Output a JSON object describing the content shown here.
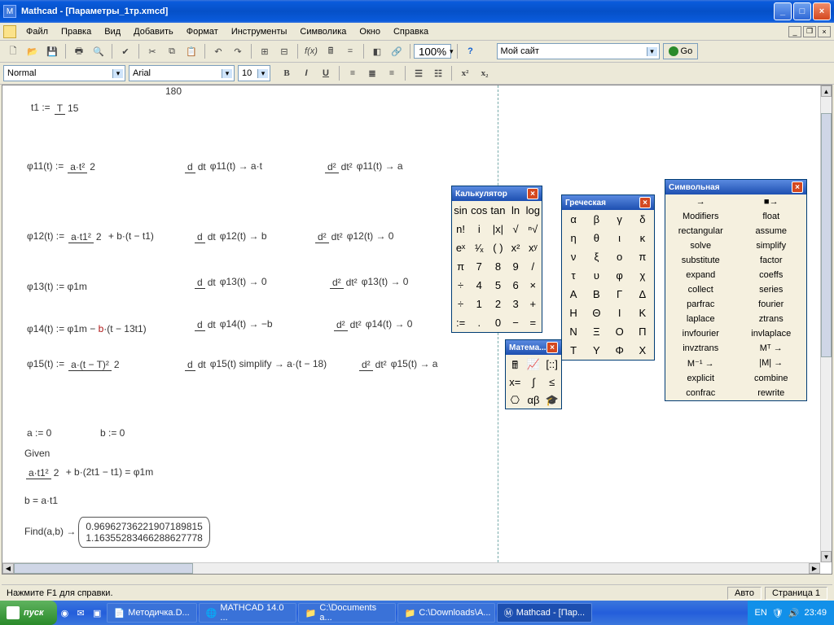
{
  "app": {
    "title": "Mathcad - [Параметры_1тр.xmcd]"
  },
  "menu": {
    "file": "Файл",
    "edit": "Правка",
    "view": "Вид",
    "insert": "Добавить",
    "format": "Формат",
    "tools": "Инструменты",
    "symbol": "Символика",
    "window": "Окно",
    "help": "Справка"
  },
  "tb2": {
    "zoom": "100%",
    "go": "Go",
    "site": "Мой сайт"
  },
  "tb3": {
    "style": "Normal",
    "font": "Arial",
    "size": "10"
  },
  "status": {
    "hint": "Нажмите F1 для справки.",
    "auto": "Авто",
    "page": "Страница 1"
  },
  "task": {
    "start": "пуск",
    "i1": "Методичка.D...",
    "i2": "MATHCAD 14.0 ...",
    "i3": "C:\\Documents a...",
    "i4": "C:\\Downloads\\A...",
    "i5": "Mathcad - [Пар...",
    "lang": "EN",
    "time": "23:49"
  },
  "pal": {
    "calc_title": "Калькулятор",
    "calc": [
      "sin",
      "cos",
      "tan",
      "ln",
      "log",
      "n!",
      "i",
      "|x|",
      "√",
      "ⁿ√",
      "eˣ",
      "¹⁄ₓ",
      "( )",
      "x²",
      "xʸ",
      "π",
      "7",
      "8",
      "9",
      "/",
      "÷",
      "4",
      "5",
      "6",
      "×",
      "÷",
      "1",
      "2",
      "3",
      "+",
      ":=",
      ".",
      "0",
      "−",
      "="
    ],
    "greek_title": "Греческая",
    "greek": [
      "α",
      "β",
      "γ",
      "δ",
      "η",
      "θ",
      "ι",
      "κ",
      "ν",
      "ξ",
      "ο",
      "π",
      "τ",
      "υ",
      "φ",
      "χ",
      "Α",
      "Β",
      "Γ",
      "Δ",
      "Η",
      "Θ",
      "Ι",
      "Κ",
      "Ν",
      "Ξ",
      "Ο",
      "Π",
      "Τ",
      "Υ",
      "Φ",
      "Χ"
    ],
    "sym_title": "Символьная",
    "sym": [
      "→",
      "■→",
      "Modifiers",
      "float",
      "rectangular",
      "assume",
      "solve",
      "simplify",
      "substitute",
      "factor",
      "expand",
      "coeffs",
      "collect",
      "series",
      "parfrac",
      "fourier",
      "laplace",
      "ztrans",
      "invfourier",
      "invlaplace",
      "invztrans",
      "Mᵀ →",
      "M⁻¹ →",
      "|M| →",
      "explicit",
      "combine",
      "confrac",
      "rewrite"
    ],
    "math_title": "Матема..."
  },
  "eq": {
    "t1": "t1 :=",
    "t1n": "T",
    "t1d": "15",
    "top": "180",
    "p11": "φ11(t) :=",
    "p11n": "a·t²",
    "p11d": "2",
    "d1": "φ11(t) → a·t",
    "dd1": "φ11(t) → a",
    "p12": "φ12(t) :=",
    "p12n": "a·t1²",
    "p12d": "2",
    "p12t": " + b·(t − t1)",
    "d2": "φ12(t) → b",
    "dd2": "φ12(t) → 0",
    "p13": "φ13(t) := φ1m",
    "d3": "φ13(t) → 0",
    "dd3": "φ13(t) → 0",
    "p14": "φ14(t) := φ1m − ",
    "p14b": "b",
    "p14t": "·(t − 13t1)",
    "d4": "φ14(t) → −b",
    "dd4": "φ14(t) → 0",
    "p15": "φ15(t) :=",
    "p15n": "a·(t − T)²",
    "p15d": "2",
    "d5": "φ15(t) simplify → a·(t − 18)",
    "dd5": "φ15(t) → a",
    "a0": "a := 0",
    "b0": "b := 0",
    "given": "Given",
    "g1": " + b·(2t1 − t1) = φ1m",
    "g1n": "a·t1²",
    "g1d": "2",
    "g2": "b = a·t1",
    "find": "Find(a,b) →",
    "fv1": "0.96962736221907189815",
    "fv2": "1.16355283466288627778"
  }
}
